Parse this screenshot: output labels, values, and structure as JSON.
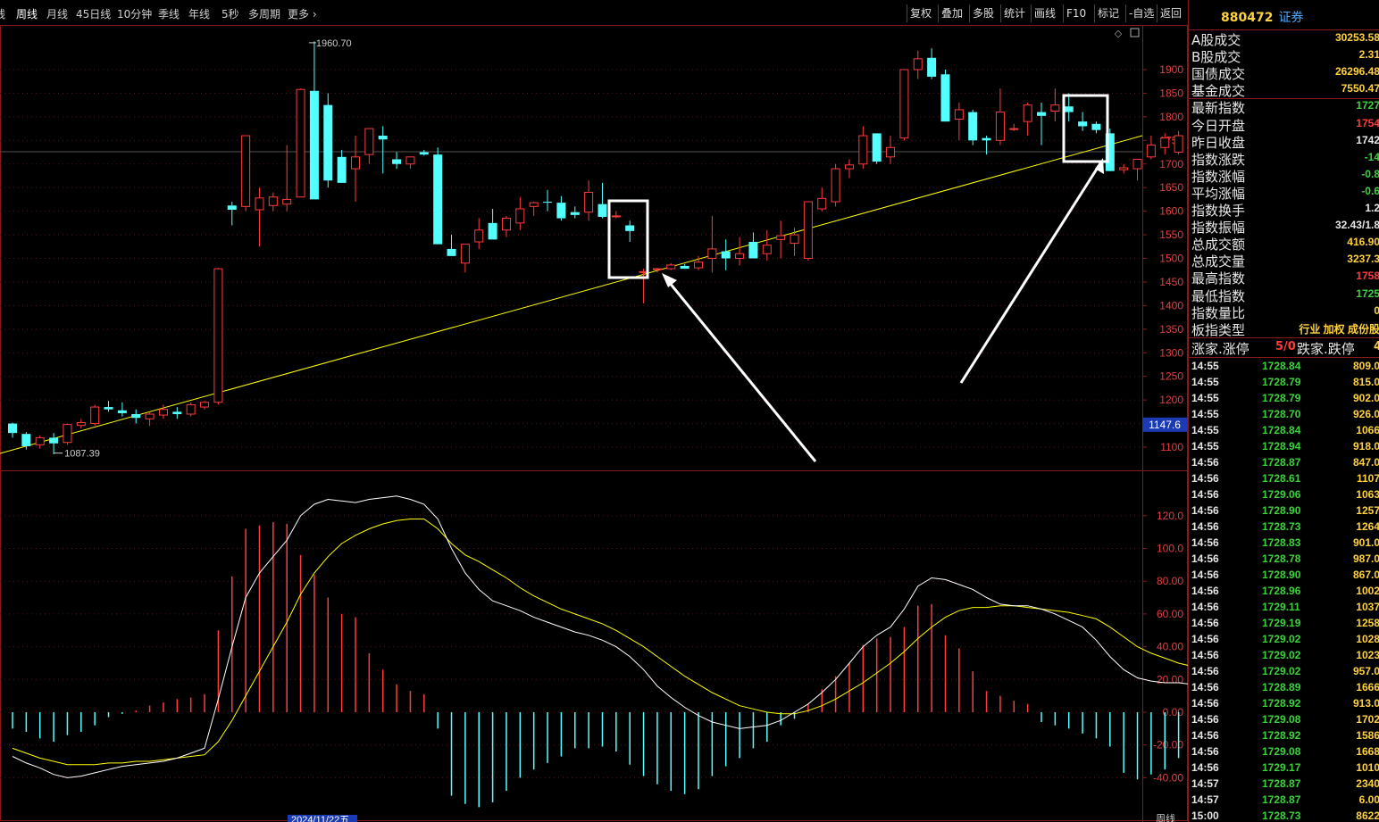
{
  "toolbar": {
    "periods": [
      "线",
      "周线",
      "月线",
      "45日线",
      "10分钟",
      "季线",
      "年线",
      "5秒",
      "多周期",
      "更多"
    ],
    "active_period": "周线",
    "buttons": [
      "复权",
      "叠加",
      "多股",
      "统计",
      "画线",
      "F10",
      "标记",
      "-自选",
      "返回"
    ]
  },
  "price_axis": {
    "ticks": [
      "1900",
      "1850",
      "1800",
      "1750",
      "1700",
      "1650",
      "1600",
      "1550",
      "1500",
      "1450",
      "1400",
      "1350",
      "1300",
      "1250",
      "1200",
      "1150",
      "1100"
    ],
    "current_label": "1147.6"
  },
  "macd_axis": {
    "ticks": [
      "120.0",
      "100.0",
      "80.00",
      "60.00",
      "40.00",
      "20.00",
      "0.00",
      "-20.00",
      "-40.00"
    ]
  },
  "annotations": {
    "high": "1960.70",
    "low": "1087.39"
  },
  "bottom_date": "2024/11/22五",
  "bottom_right_label": "周线",
  "colors": {
    "up": "#ff3b3b",
    "down": "#54ffff",
    "dif": "#ffffff",
    "dea": "#ffff00",
    "trendline": "#ffff00",
    "frame": "#8a1a1a"
  },
  "chart_data": [
    {
      "type": "candlestick",
      "title": "",
      "ylim": [
        1080,
        1980
      ],
      "candles": [
        [
          1150,
          1152,
          1120,
          1130
        ],
        [
          1128,
          1132,
          1095,
          1102
        ],
        [
          1105,
          1125,
          1097,
          1120
        ],
        [
          1120,
          1130,
          1085,
          1108
        ],
        [
          1110,
          1150,
          1105,
          1148
        ],
        [
          1146,
          1160,
          1140,
          1152
        ],
        [
          1150,
          1190,
          1145,
          1185
        ],
        [
          1185,
          1198,
          1175,
          1180
        ],
        [
          1178,
          1195,
          1165,
          1172
        ],
        [
          1170,
          1180,
          1150,
          1162
        ],
        [
          1160,
          1175,
          1145,
          1170
        ],
        [
          1168,
          1190,
          1160,
          1180
        ],
        [
          1175,
          1185,
          1160,
          1170
        ],
        [
          1170,
          1195,
          1165,
          1190
        ],
        [
          1185,
          1198,
          1180,
          1195
        ],
        [
          1195,
          1480,
          1190,
          1478
        ],
        [
          1612,
          1620,
          1570,
          1603
        ],
        [
          1610,
          1760,
          1600,
          1760
        ],
        [
          1603,
          1650,
          1525,
          1628
        ],
        [
          1612,
          1640,
          1600,
          1630
        ],
        [
          1615,
          1740,
          1600,
          1625
        ],
        [
          1630,
          1860,
          1630,
          1858
        ],
        [
          1855,
          1960,
          1630,
          1625
        ],
        [
          1825,
          1850,
          1650,
          1665
        ],
        [
          1715,
          1730,
          1670,
          1660
        ],
        [
          1690,
          1760,
          1620,
          1715
        ],
        [
          1720,
          1760,
          1700,
          1775
        ],
        [
          1760,
          1780,
          1680,
          1752
        ],
        [
          1710,
          1725,
          1690,
          1700
        ],
        [
          1700,
          1710,
          1690,
          1715
        ],
        [
          1725,
          1730,
          1718,
          1720
        ],
        [
          1720,
          1735,
          1530,
          1530
        ],
        [
          1520,
          1550,
          1505,
          1505
        ],
        [
          1490,
          1530,
          1470,
          1530
        ],
        [
          1535,
          1585,
          1520,
          1560
        ],
        [
          1575,
          1605,
          1560,
          1540
        ],
        [
          1560,
          1590,
          1545,
          1585
        ],
        [
          1575,
          1630,
          1560,
          1605
        ],
        [
          1610,
          1620,
          1590,
          1618
        ],
        [
          1620,
          1645,
          1600,
          1618
        ],
        [
          1618,
          1632,
          1580,
          1585
        ],
        [
          1598,
          1610,
          1585,
          1592
        ],
        [
          1598,
          1665,
          1580,
          1640
        ],
        [
          1615,
          1660,
          1585,
          1588
        ],
        [
          1590,
          1600,
          1585,
          1590
        ],
        [
          1570,
          1580,
          1535,
          1558
        ],
        [
          1470,
          1478,
          1405,
          1472
        ],
        [
          1478,
          1480,
          1470,
          1478
        ],
        [
          1478,
          1490,
          1475,
          1486
        ],
        [
          1484,
          1488,
          1478,
          1478
        ],
        [
          1480,
          1505,
          1475,
          1492
        ],
        [
          1500,
          1590,
          1470,
          1520
        ],
        [
          1515,
          1540,
          1475,
          1500
        ],
        [
          1500,
          1545,
          1485,
          1510
        ],
        [
          1535,
          1555,
          1505,
          1500
        ],
        [
          1510,
          1560,
          1495,
          1528
        ],
        [
          1540,
          1580,
          1500,
          1548
        ],
        [
          1532,
          1565,
          1505,
          1550
        ],
        [
          1500,
          1600,
          1495,
          1620
        ],
        [
          1605,
          1650,
          1600,
          1627
        ],
        [
          1620,
          1700,
          1610,
          1690
        ],
        [
          1690,
          1710,
          1670,
          1698
        ],
        [
          1700,
          1780,
          1690,
          1760
        ],
        [
          1765,
          1765,
          1700,
          1705
        ],
        [
          1715,
          1760,
          1700,
          1735
        ],
        [
          1755,
          1890,
          1750,
          1900
        ],
        [
          1900,
          1940,
          1880,
          1923
        ],
        [
          1925,
          1945,
          1880,
          1885
        ],
        [
          1890,
          1900,
          1790,
          1790
        ],
        [
          1795,
          1830,
          1750,
          1815
        ],
        [
          1810,
          1815,
          1740,
          1750
        ],
        [
          1755,
          1760,
          1720,
          1750
        ],
        [
          1750,
          1860,
          1740,
          1810
        ],
        [
          1775,
          1785,
          1770,
          1775
        ],
        [
          1790,
          1830,
          1760,
          1825
        ],
        [
          1810,
          1830,
          1740,
          1802
        ],
        [
          1812,
          1860,
          1790,
          1825
        ],
        [
          1822,
          1850,
          1790,
          1810
        ],
        [
          1790,
          1810,
          1770,
          1780
        ],
        [
          1785,
          1790,
          1765,
          1772
        ],
        [
          1765,
          1775,
          1685,
          1685
        ],
        [
          1688,
          1700,
          1680,
          1692
        ],
        [
          1690,
          1710,
          1665,
          1710
        ],
        [
          1715,
          1760,
          1710,
          1740
        ],
        [
          1735,
          1765,
          1720,
          1755
        ],
        [
          1725,
          1770,
          1720,
          1760
        ],
        [
          1770,
          1780,
          1760,
          1760
        ],
        [
          1775,
          1780,
          1755,
          1758
        ],
        [
          1757,
          1840,
          1745,
          1775
        ],
        [
          1775,
          1830,
          1730,
          1745
        ]
      ]
    },
    {
      "type": "line",
      "title": "",
      "ylim": [
        -50,
        140
      ],
      "series": [
        {
          "values": [
            -27,
            -31,
            -34,
            -38,
            -40,
            -39,
            -37,
            -35,
            -33,
            -32,
            -31,
            -30,
            -28,
            -25,
            -22,
            8,
            40,
            70,
            85,
            95,
            105,
            120,
            127,
            130,
            129,
            128,
            130,
            131,
            132,
            130,
            127,
            118,
            100,
            85,
            75,
            68,
            65,
            62,
            58,
            55,
            52,
            49,
            47,
            44,
            40,
            34,
            26,
            16,
            9,
            3,
            -2,
            -6,
            -8,
            -10,
            -9,
            -8,
            -5,
            0,
            5,
            12,
            20,
            30,
            40,
            47,
            52,
            63,
            77,
            82,
            81,
            78,
            75,
            70,
            66,
            65,
            65,
            63,
            60,
            56,
            52,
            44,
            34,
            26,
            21,
            19,
            18,
            18,
            17,
            16,
            17,
            16,
            13
          ]
        },
        {
          "values": [
            -22,
            -25,
            -28,
            -30,
            -32,
            -32,
            -32,
            -31,
            -31,
            -30,
            -30,
            -29,
            -28,
            -27,
            -26,
            -18,
            -5,
            10,
            25,
            40,
            55,
            72,
            85,
            95,
            103,
            108,
            112,
            115,
            117,
            118,
            118,
            112,
            103,
            96,
            92,
            87,
            82,
            76,
            71,
            67,
            63,
            60,
            57,
            54,
            50,
            45,
            40,
            34,
            28,
            22,
            17,
            12,
            8,
            4,
            2,
            0,
            -1,
            -1,
            1,
            4,
            8,
            13,
            18,
            24,
            30,
            37,
            45,
            52,
            58,
            62,
            64,
            64,
            65,
            65,
            64,
            63,
            62,
            61,
            59,
            57,
            52,
            46,
            40,
            36,
            33,
            30,
            28,
            26,
            24,
            22,
            21
          ]
        },
        {
          "values": [
            -10,
            -12,
            -16,
            -18,
            -14,
            -12,
            -8,
            -3,
            -1,
            1,
            4,
            6,
            8,
            9,
            11,
            50,
            83,
            112,
            114,
            116,
            115,
            96,
            84,
            70,
            60,
            58,
            36,
            26,
            17,
            13,
            11,
            -10,
            -51,
            -56,
            -58,
            -55,
            -48,
            -40,
            -35,
            -31,
            -27,
            -22,
            -22,
            -21,
            -24,
            -32,
            -39,
            -44,
            -48,
            -50,
            -47,
            -39,
            -33,
            -28,
            -22,
            -18,
            -8,
            -4,
            5,
            14,
            22,
            30,
            41,
            45,
            46,
            52,
            65,
            66,
            47,
            39,
            25,
            13,
            10,
            7,
            5,
            -6,
            -8,
            -10,
            -13,
            -16,
            -21,
            -37,
            -41,
            -38,
            -35,
            -28,
            -24,
            -20,
            -17,
            -14,
            -16
          ]
        }
      ]
    }
  ],
  "right_panel": {
    "code": "880472",
    "name": "证券",
    "stats": [
      {
        "label": "A股成交",
        "value": "30253.58",
        "color": "#ffd23c"
      },
      {
        "label": "B股成交",
        "value": "2.31",
        "color": "#ffd23c"
      },
      {
        "label": "国债成交",
        "value": "26296.48",
        "color": "#ffd23c"
      },
      {
        "label": "基金成交",
        "value": "7550.47",
        "color": "#ffd23c"
      },
      {
        "label": "最新指数",
        "value": "1727",
        "color": "#3cd23c"
      },
      {
        "label": "今日开盘",
        "value": "1754",
        "color": "#ff3b3b"
      },
      {
        "label": "昨日收盘",
        "value": "1742",
        "color": "#e6e6e6"
      },
      {
        "label": "指数涨跌",
        "value": "-14",
        "color": "#3cd23c"
      },
      {
        "label": "指数涨幅",
        "value": "-0.8",
        "color": "#3cd23c"
      },
      {
        "label": "平均涨幅",
        "value": "-0.6",
        "color": "#3cd23c"
      },
      {
        "label": "指数换手",
        "value": "1.2",
        "color": "#e6e6e6"
      },
      {
        "label": "指数振幅",
        "value": "32.43/1.8",
        "color": "#e6e6e6"
      },
      {
        "label": "总成交额",
        "value": "416.90",
        "color": "#ffd23c"
      },
      {
        "label": "总成交量",
        "value": "3237.3",
        "color": "#ffd23c"
      },
      {
        "label": "最高指数",
        "value": "1758",
        "color": "#ff3b3b"
      },
      {
        "label": "最低指数",
        "value": "1725",
        "color": "#3cd23c"
      },
      {
        "label": "指数量比",
        "value": "0",
        "color": "#ffd23c"
      },
      {
        "label": "板指类型",
        "value": "行业 加权 成份股",
        "color": "#ffd23c"
      }
    ],
    "updown": {
      "label_up": "涨家.涨停",
      "value_up": "5/0",
      "label_down": "跌家.跌停",
      "value_down": "4"
    },
    "ticks": [
      {
        "t": "14:55",
        "p": "1728.84",
        "v": "809.0"
      },
      {
        "t": "14:55",
        "p": "1728.79",
        "v": "815.0"
      },
      {
        "t": "14:55",
        "p": "1728.79",
        "v": "902.0"
      },
      {
        "t": "14:55",
        "p": "1728.70",
        "v": "926.0"
      },
      {
        "t": "14:55",
        "p": "1728.84",
        "v": "1066"
      },
      {
        "t": "14:55",
        "p": "1728.94",
        "v": "918.0"
      },
      {
        "t": "14:56",
        "p": "1728.87",
        "v": "847.0"
      },
      {
        "t": "14:56",
        "p": "1728.61",
        "v": "1107"
      },
      {
        "t": "14:56",
        "p": "1729.06",
        "v": "1063"
      },
      {
        "t": "14:56",
        "p": "1728.90",
        "v": "1257"
      },
      {
        "t": "14:56",
        "p": "1728.73",
        "v": "1264"
      },
      {
        "t": "14:56",
        "p": "1728.83",
        "v": "901.0"
      },
      {
        "t": "14:56",
        "p": "1728.78",
        "v": "987.0"
      },
      {
        "t": "14:56",
        "p": "1728.90",
        "v": "867.0"
      },
      {
        "t": "14:56",
        "p": "1728.96",
        "v": "1002"
      },
      {
        "t": "14:56",
        "p": "1729.11",
        "v": "1037"
      },
      {
        "t": "14:56",
        "p": "1729.19",
        "v": "1258"
      },
      {
        "t": "14:56",
        "p": "1729.02",
        "v": "1028"
      },
      {
        "t": "14:56",
        "p": "1729.02",
        "v": "1023"
      },
      {
        "t": "14:56",
        "p": "1729.02",
        "v": "957.0"
      },
      {
        "t": "14:56",
        "p": "1728.89",
        "v": "1666"
      },
      {
        "t": "14:56",
        "p": "1728.92",
        "v": "913.0"
      },
      {
        "t": "14:56",
        "p": "1729.08",
        "v": "1702"
      },
      {
        "t": "14:56",
        "p": "1728.92",
        "v": "1586"
      },
      {
        "t": "14:56",
        "p": "1729.08",
        "v": "1668"
      },
      {
        "t": "14:56",
        "p": "1729.17",
        "v": "1010"
      },
      {
        "t": "14:57",
        "p": "1728.87",
        "v": "2340"
      },
      {
        "t": "14:57",
        "p": "1728.87",
        "v": "6.00"
      },
      {
        "t": "15:00",
        "p": "1728.73",
        "v": "8622"
      }
    ]
  }
}
